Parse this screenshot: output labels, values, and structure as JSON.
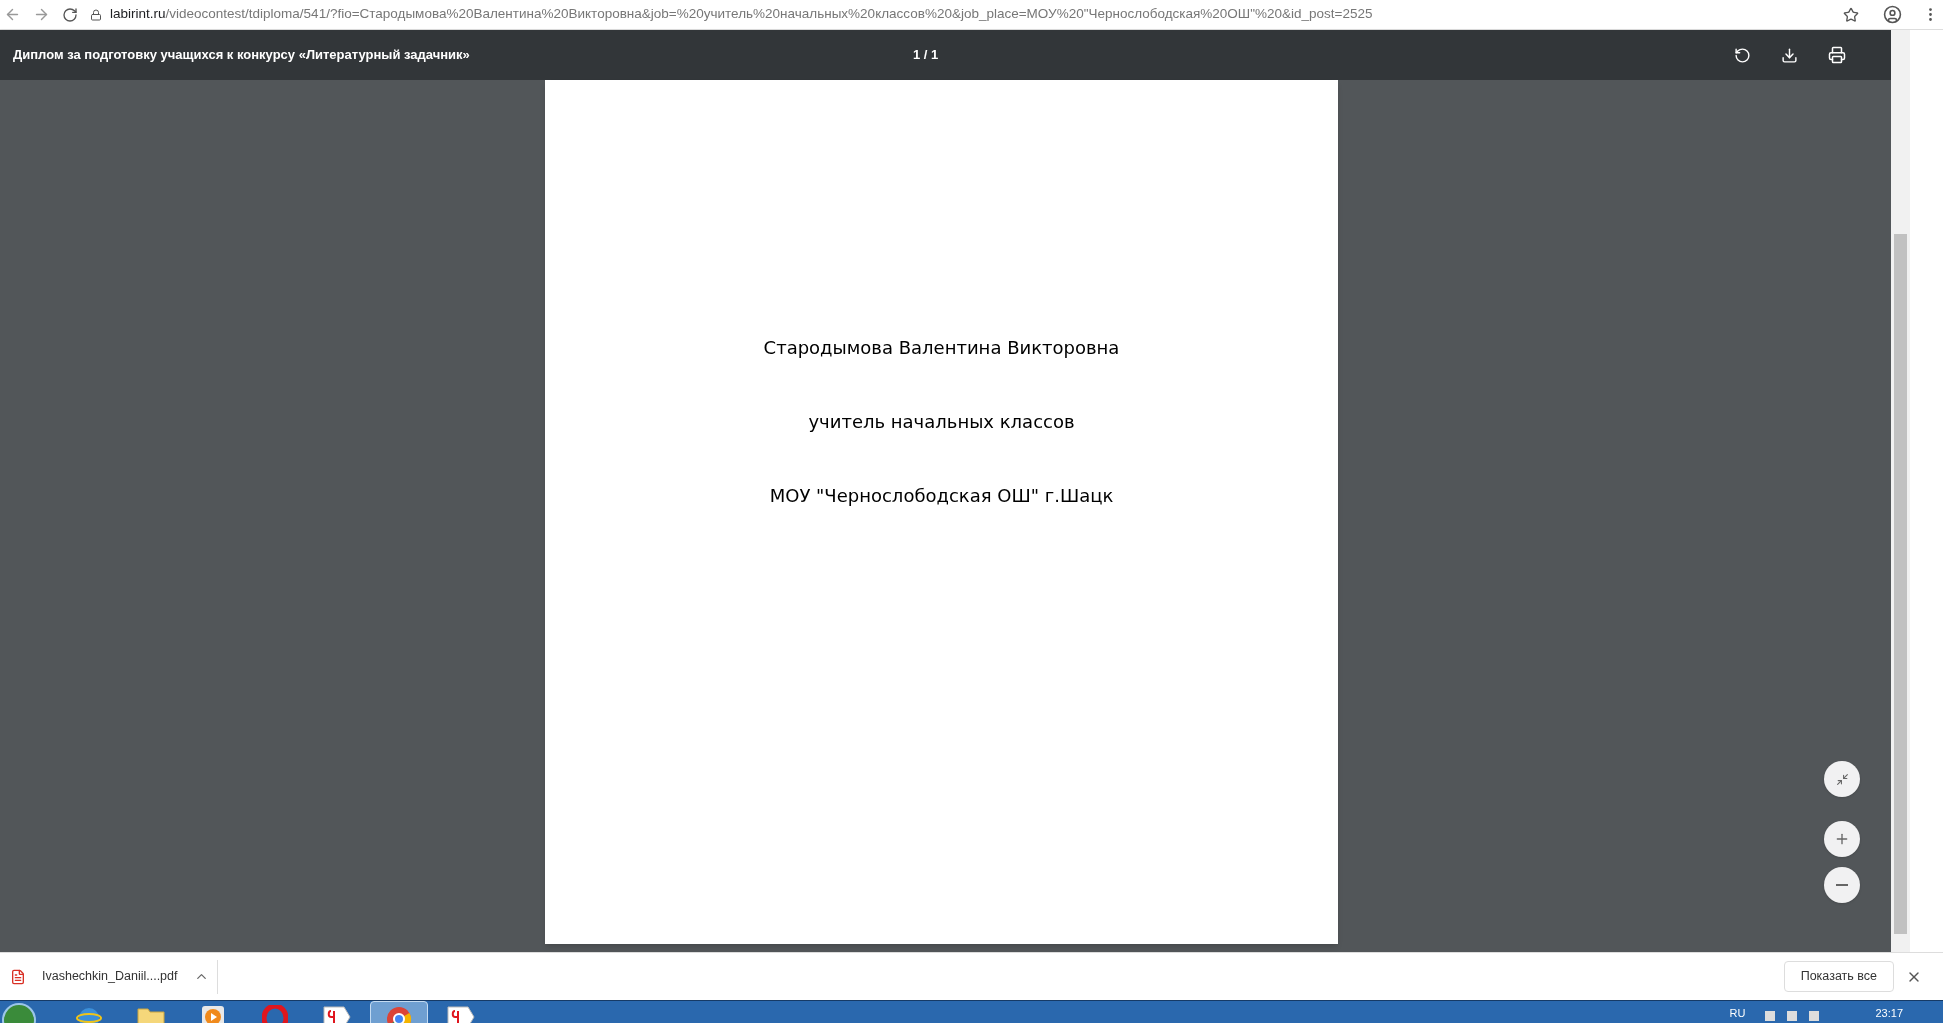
{
  "browser": {
    "url_host": "labirint.ru",
    "url_path": "/videocontest/tdiploma/541/?fio=Стародымова%20Валентина%20Викторовна&job=%20учитель%20начальных%20классов%20&job_place=МОУ%20\"Чернослободская%20ОШ\"%20&id_post=2525"
  },
  "viewer": {
    "title": "Диплом за подготовку учащихся к конкурсу «Литературный задачник»",
    "page_counter": "1 / 1"
  },
  "document": {
    "lines": [
      "Стародымова Валентина Викторовна",
      "учитель начальных классов",
      "МОУ \"Чернослободская ОШ\" г.Шацк"
    ]
  },
  "downloads": {
    "file_name": "Ivashechkin_Daniil....pdf",
    "show_all": "Показать все"
  },
  "taskbar": {
    "apps": [
      {
        "kind": "ie",
        "selected": false
      },
      {
        "kind": "folder",
        "selected": false
      },
      {
        "kind": "media",
        "selected": false
      },
      {
        "kind": "opera",
        "selected": false
      },
      {
        "kind": "yandex",
        "selected": false
      },
      {
        "kind": "chrome",
        "selected": true
      },
      {
        "kind": "yandex",
        "selected": false
      }
    ],
    "language": "RU",
    "clock": "23:17"
  }
}
